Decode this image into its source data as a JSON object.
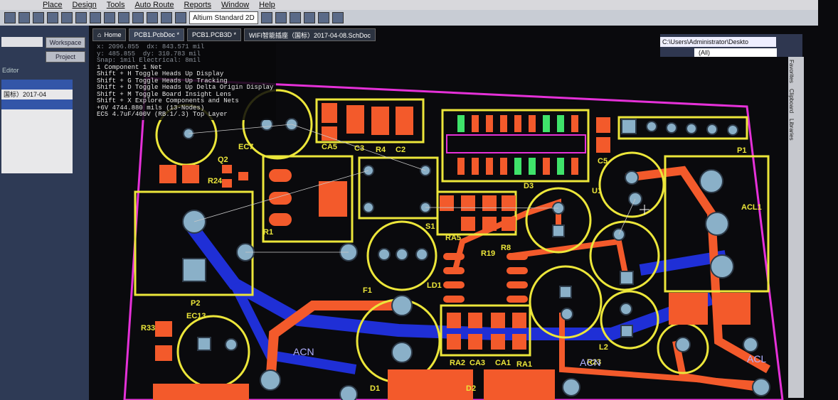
{
  "menu": [
    "Place",
    "Design",
    "Tools",
    "Auto Route",
    "Reports",
    "Window",
    "Help"
  ],
  "toolbar": {
    "view_mode": "Altium Standard 2D"
  },
  "tabs": [
    {
      "label": "Home"
    },
    {
      "label": "PCB1.PcbDoc *"
    },
    {
      "label": "PCB1.PCB3D *"
    },
    {
      "label": "WIFI智能插座（国标）2017-04-08.SchDoc"
    }
  ],
  "left_panel": {
    "workspace_button": "Workspace",
    "project_button": "Project",
    "editor_label": "Editor",
    "file_item": "国标）2017-04"
  },
  "right_panel": {
    "path": "C:\\Users\\Administrator\\Deskto",
    "filter": "(All)"
  },
  "side_tabs": [
    "Favorites",
    "Clipboard",
    "Libraries"
  ],
  "hud": {
    "x": "x:  2096.855",
    "dx": "dx:  843.571 mil",
    "y": "y:  485.855",
    "dy": "dy:  310.783 mil",
    "snap": "Snap: 1mil Electrical: 8mil",
    "component": "1 Component 1 Net",
    "shortcuts": [
      "Shift + H   Toggle Heads Up Display",
      "Shift + G   Toggle Heads Up Tracking",
      "Shift + D   Toggle Heads Up Delta Origin Display",
      "Shift + M   Toggle Board Insight Lens",
      "Shift + X   Explore Components and Nets"
    ],
    "net": "+6V   4744.880 mils (13-Nodes)",
    "part": "EC5 4.7uF/400V (RB.1/.3) Top Layer"
  },
  "designators": [
    "CA5",
    "C3",
    "R4",
    "C2",
    "D3",
    "C5",
    "P1",
    "U1",
    "R24",
    "Q2",
    "EC7",
    "R1",
    "S1",
    "RA5",
    "R19",
    "R8",
    "LD1",
    "F1",
    "P2",
    "EC13",
    "R33",
    "RA2",
    "CA3",
    "CA1",
    "RA1",
    "L2",
    "ACN",
    "ACL1",
    "ACL",
    "R23",
    "D1",
    "D2"
  ],
  "colors": {
    "board_bg": "#0a0a0d",
    "silk": "#ece63a",
    "pad": "#f35a2b",
    "track": "#f35a2b",
    "bottom_track": "#1f2fd6",
    "outline": "#e531d8",
    "highlight_pad": "#3fe36a",
    "via": "#8ab0c8"
  }
}
